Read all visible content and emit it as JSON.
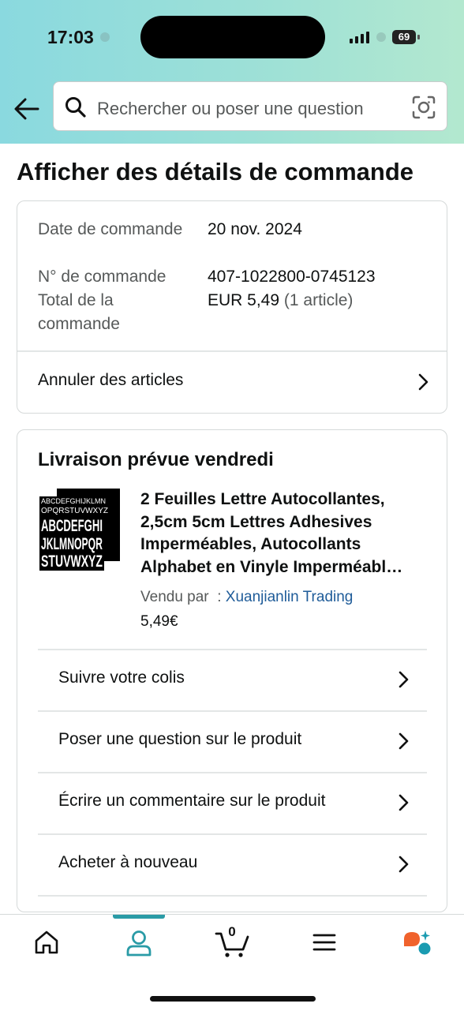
{
  "status_bar": {
    "time": "17:03",
    "battery": "69"
  },
  "search": {
    "placeholder": "Rechercher ou poser une question"
  },
  "page": {
    "title": "Afficher des détails de commande"
  },
  "order_summary": {
    "date_label": "Date de commande",
    "date_value": "20 nov. 2024",
    "number_label": "N° de commande",
    "number_value": "407-1022800-0745123",
    "total_label": "Total de la commande",
    "total_value": "EUR 5,49",
    "total_items": "(1 article)",
    "cancel_label": "Annuler des articles"
  },
  "delivery": {
    "title": "Livraison prévue vendredi",
    "product": {
      "title": "2 Feuilles Lettre Autocollantes, 2,5cm 5cm Lettres Adhesives Imperméables, Autocollants Alphabet en Vinyle Imperméabl…",
      "seller_prefix": "Vendu par",
      "seller_sep": ":",
      "seller_name": "Xuanjianlin Trading",
      "price": "5,49€",
      "thumb_lines": [
        "ABCDEFGHIJKLMN",
        "OPQRSTUVWXYZ",
        "ABCDEFGHI",
        "JKLMNOPQR",
        "STUVWXYZ"
      ]
    },
    "actions": [
      {
        "label": "Suivre votre colis"
      },
      {
        "label": "Poser une question sur le produit"
      },
      {
        "label": "Écrire un commentaire sur le produit"
      },
      {
        "label": "Acheter à nouveau"
      }
    ]
  },
  "bottom_nav": {
    "cart_count": "0",
    "active": "account",
    "icons": [
      "home-icon",
      "account-icon",
      "cart-icon",
      "menu-icon",
      "rufus-icon"
    ],
    "accent_color": "#2a9ba6"
  }
}
